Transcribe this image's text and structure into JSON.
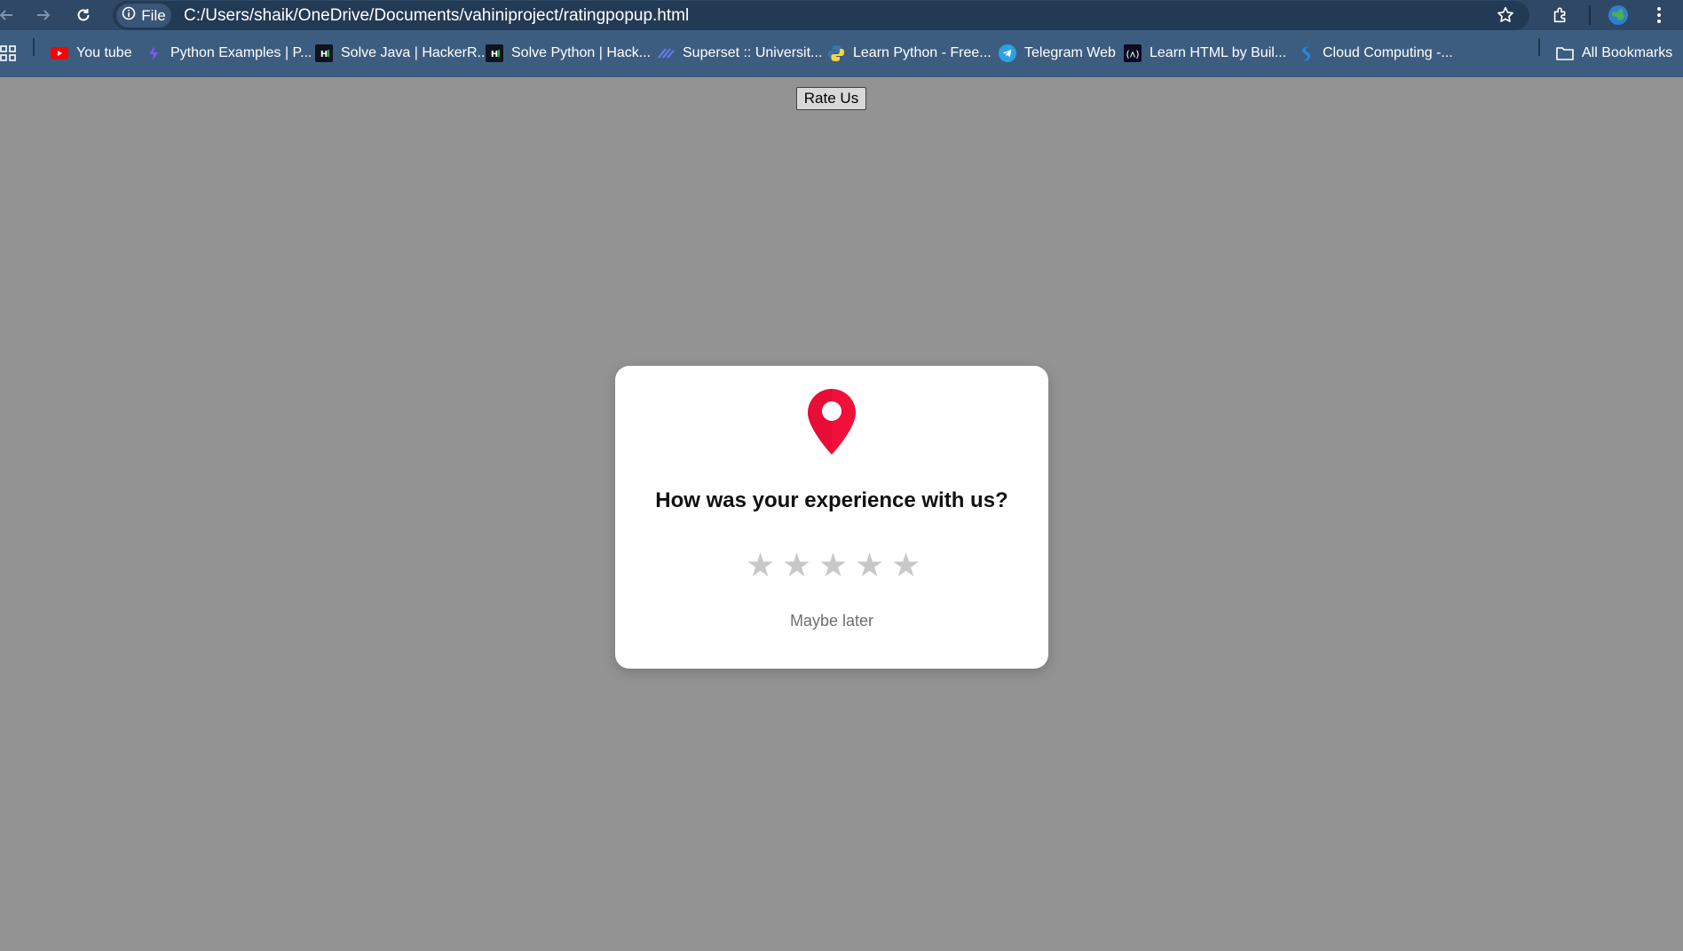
{
  "browser": {
    "file_chip_label": "File",
    "url": "C:/Users/shaik/OneDrive/Documents/vahiniproject/ratingpopup.html"
  },
  "bookmarks": {
    "items": [
      {
        "label": "You tube",
        "icon": "youtube-icon",
        "color": "#ff0000"
      },
      {
        "label": "Python Examples | P...",
        "icon": "python-examples-icon",
        "color": "#7b5cff"
      },
      {
        "label": "Solve Java | HackerR...",
        "icon": "hackerrank-icon",
        "color": "#1ba94c"
      },
      {
        "label": "Solve Python | Hack...",
        "icon": "hackerrank-icon",
        "color": "#1ba94c"
      },
      {
        "label": "Superset :: Universit...",
        "icon": "superset-icon",
        "color": "#6b7cff"
      },
      {
        "label": "Learn Python - Free...",
        "icon": "python-icon",
        "color": "#3776ab"
      },
      {
        "label": "Telegram Web",
        "icon": "telegram-icon",
        "color": "#2aa3e0"
      },
      {
        "label": "Learn HTML by Buil...",
        "icon": "freecodecamp-icon",
        "color": "#0a0a23"
      },
      {
        "label": "Cloud Computing -...",
        "icon": "cloud-icon",
        "color": "#1e88e5"
      }
    ],
    "all_bookmarks_label": "All Bookmarks"
  },
  "page": {
    "rate_button_label": "Rate Us",
    "popup": {
      "icon": "location-pin-icon",
      "icon_color": "#f0103a",
      "title": "How was your experience with us?",
      "stars": [
        "★",
        "★",
        "★",
        "★",
        "★"
      ],
      "rating": 0,
      "rating_max": 5,
      "dismiss_label": "Maybe later"
    }
  }
}
